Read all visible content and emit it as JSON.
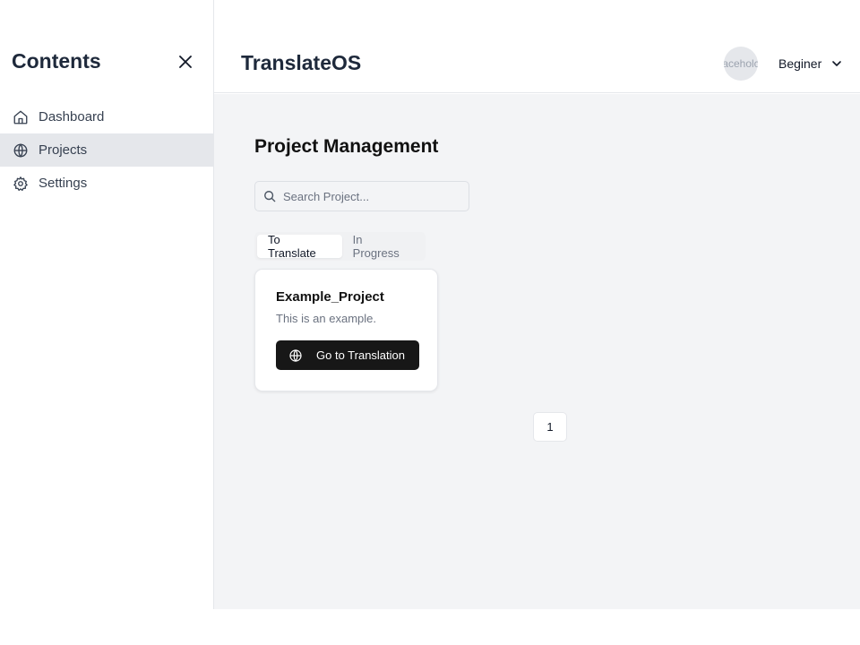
{
  "sidebar": {
    "title": "Contents",
    "items": [
      {
        "label": "Dashboard",
        "icon": "home-icon",
        "active": false
      },
      {
        "label": "Projects",
        "icon": "globe-icon",
        "active": true
      },
      {
        "label": "Settings",
        "icon": "gear-icon",
        "active": false
      }
    ]
  },
  "header": {
    "title": "TranslateOS",
    "avatar_text": "aceholc",
    "user_level": "Beginer"
  },
  "main": {
    "page_title": "Project Management",
    "search": {
      "placeholder": "Search Project...",
      "value": ""
    },
    "tabs": [
      {
        "label": "To Translate",
        "active": true
      },
      {
        "label": "In Progress",
        "active": false
      }
    ],
    "project_card": {
      "title": "Example_Project",
      "description": "This is an example.",
      "button_label": "Go to Translation",
      "button_icon": "globe-icon"
    },
    "pagination": {
      "current_page": "1"
    }
  },
  "colors": {
    "sidebar_active": "#e5e7eb",
    "main_bg": "#f3f4f6",
    "button_bg": "#171717",
    "title_text": "#1e293b"
  }
}
